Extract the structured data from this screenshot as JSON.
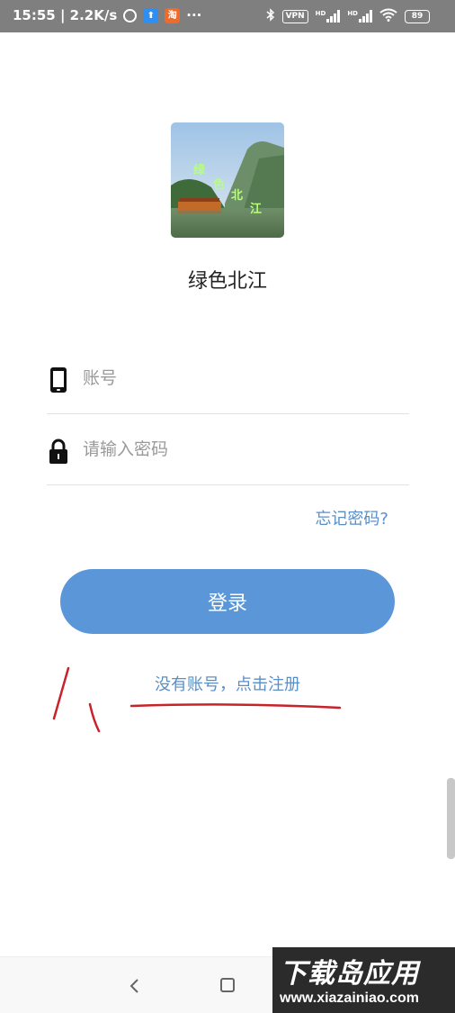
{
  "status_bar": {
    "time_speed": "15:55 | 2.2K/s",
    "app1": "⬆",
    "app2": "淘",
    "more": "···",
    "vpn": "VPN",
    "hd1": "HD",
    "hd2": "HD",
    "battery": "89"
  },
  "logo": {
    "chars": [
      "绿",
      "色",
      "北",
      "江"
    ]
  },
  "app_name": "绿色北江",
  "form": {
    "account_placeholder": "账号",
    "password_placeholder": "请输入密码"
  },
  "forgot_password": "忘记密码?",
  "login_button": "登录",
  "register_link": "没有账号，点击注册",
  "watermark": {
    "title": "下载岛应用",
    "url": "www.xiazainiao.com"
  },
  "colors": {
    "accent": "#5b97d8",
    "link": "#5a8fc6",
    "annotation": "#c8222a"
  }
}
